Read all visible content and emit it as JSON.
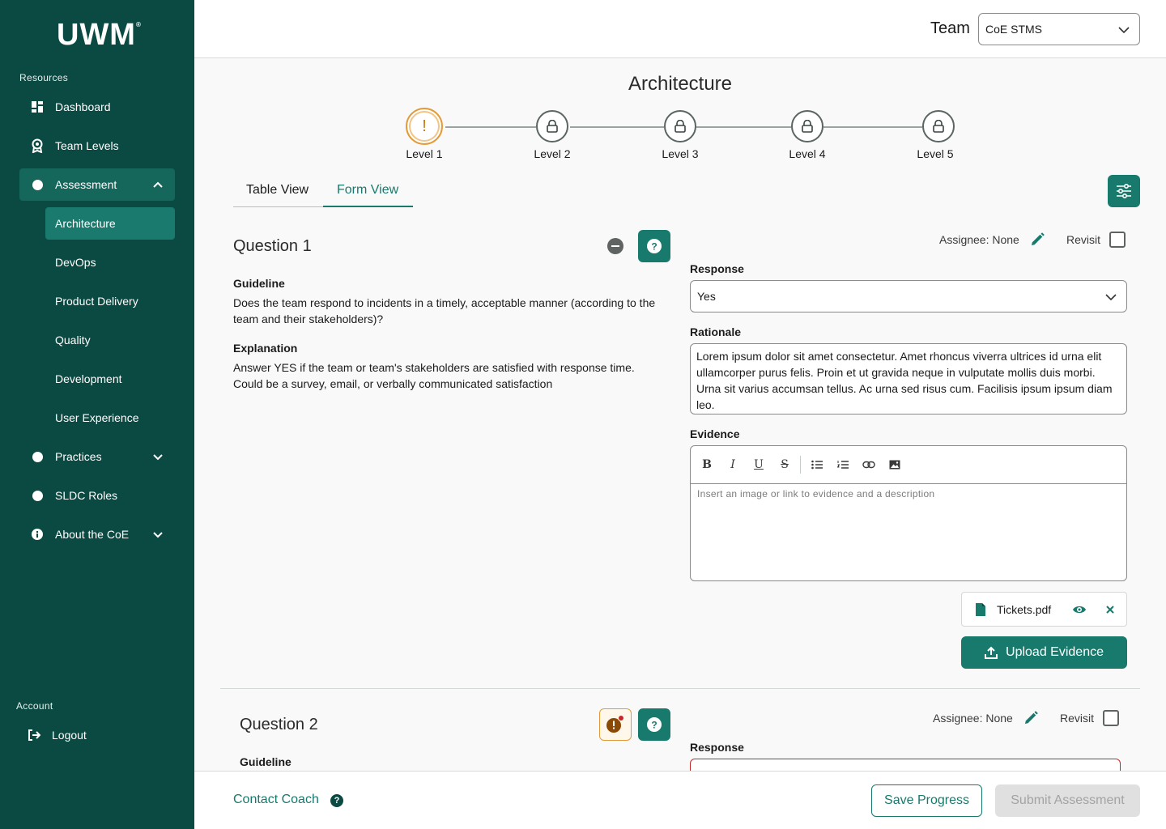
{
  "sidebar": {
    "logo": "UWM",
    "logo_mark": "®",
    "resources_label": "Resources",
    "items": [
      {
        "label": "Dashboard",
        "icon": "dashboard-icon"
      },
      {
        "label": "Team Levels",
        "icon": "award-icon"
      },
      {
        "label": "Assessment",
        "icon": "circle-icon",
        "expanded": true
      },
      {
        "label": "Practices",
        "icon": "circle-icon"
      },
      {
        "label": "SLDC Roles",
        "icon": "circle-icon"
      },
      {
        "label": "About the CoE",
        "icon": "info-icon"
      }
    ],
    "assessment_sub": [
      "Architecture",
      "DevOps",
      "Product Delivery",
      "Quality",
      "Development",
      "User Experience"
    ],
    "account_label": "Account",
    "logout": "Logout"
  },
  "header": {
    "team_label": "Team",
    "team_value": "CoE STMS"
  },
  "main": {
    "title": "Architecture",
    "levels": [
      "Level 1",
      "Level 2",
      "Level 3",
      "Level 4",
      "Level 5"
    ],
    "current_level_icon": "!",
    "tabs": {
      "table": "Table View",
      "form": "Form View"
    },
    "accent": "#177a6c",
    "sidebar_bg": "#0b4a42"
  },
  "question1": {
    "title": "Question 1",
    "guideline_label": "Guideline",
    "guideline": "Does the team respond to incidents in a timely, acceptable manner (according to the team and their stakeholders)?",
    "explanation_label": "Explanation",
    "explanation": "Answer YES if the team or team's stakeholders are satisfied with response time. Could be a survey, email, or verbally communicated satisfaction",
    "assignee": "Assignee: None",
    "revisit": "Revisit",
    "response_label": "Response",
    "response_value": "Yes",
    "rationale_label": "Rationale",
    "rationale": "Lorem ipsum dolor sit amet consectetur. Amet rhoncus viverra ultrices id urna elit ullamcorper purus felis. Proin et ut gravida neque in vulputate mollis duis morbi. Urna sit varius accumsan tellus. Ac urna sed risus cum. Facilisis ipsum ipsum diam leo.",
    "evidence_label": "Evidence",
    "evidence_placeholder": "Insert an image or link to evidence and a description",
    "file_name": "Tickets.pdf",
    "upload_label": "Upload Evidence"
  },
  "question2": {
    "title": "Question 2",
    "guideline_label": "Guideline",
    "assignee": "Assignee: None",
    "revisit": "Revisit",
    "response_label": "Response"
  },
  "footer": {
    "contact": "Contact Coach",
    "save": "Save Progress",
    "submit": "Submit Assessment"
  }
}
